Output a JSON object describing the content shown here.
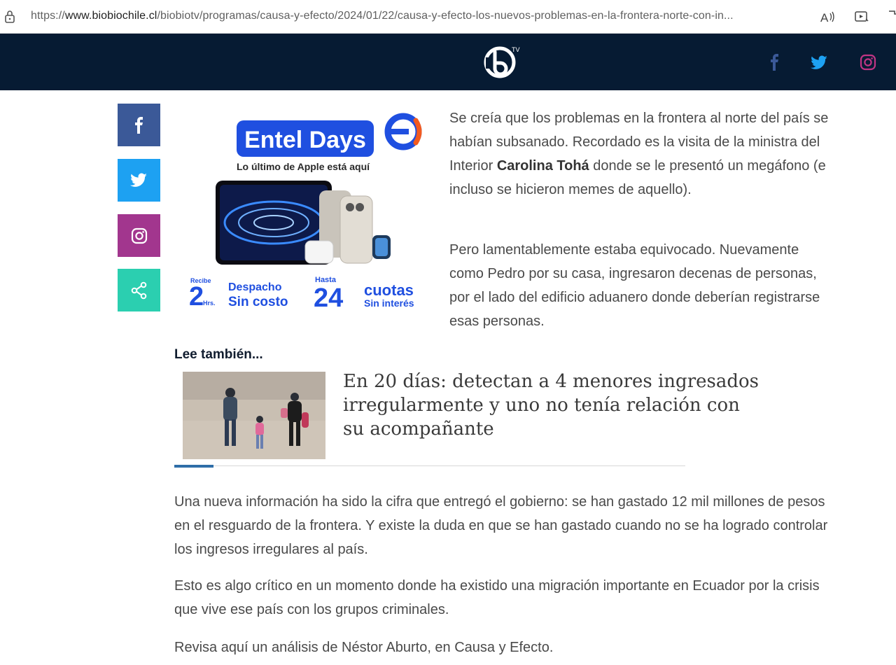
{
  "browser": {
    "url_prefix": "https://",
    "url_domain": "www.biobiochile.cl",
    "url_path": "/biobiotv/programas/causa-y-efecto/2024/01/22/causa-y-efecto-los-nuevos-problemas-en-la-frontera-norte-con-in..."
  },
  "header": {
    "logo_text": "TV",
    "socials": [
      "facebook-icon",
      "twitter-icon",
      "instagram-icon"
    ],
    "colors": {
      "background": "#061b33",
      "facebook": "#3b5998",
      "twitter": "#1da1f2",
      "instagram": "#c13584"
    }
  },
  "share": {
    "buttons": [
      {
        "icon": "facebook-icon",
        "color": "#3b5998"
      },
      {
        "icon": "twitter-icon",
        "color": "#1da1f2"
      },
      {
        "icon": "instagram-icon",
        "color": "#a2368e"
      },
      {
        "icon": "share-icon",
        "color": "#2bcfb0"
      }
    ]
  },
  "ad": {
    "brand": "Entel Days",
    "subtitle": "Lo último de Apple está aquí",
    "delivery_top": "Recibe",
    "delivery_num": "2",
    "delivery_unit": "Hrs.",
    "delivery_line1": "Despacho",
    "delivery_line2": "Sin costo",
    "cuotas_top": "Hasta",
    "cuotas_num": "24",
    "cuotas_line1": "cuotas",
    "cuotas_line2": "Sin interés"
  },
  "article": {
    "p1_before": "Se creía que los problemas en la frontera al norte del país se habían subsanado. Recordado es la visita de la ministra del Interior ",
    "p1_bold": "Carolina Tohá",
    "p1_after": " donde se le presentó un megáfono (e incluso se hicieron memes de aquello).",
    "p2": "Pero lamentablemente estaba equivocado. Nuevamente como Pedro por su casa, ingresaron decenas de personas, por el lado del edificio aduanero donde deberían registrarse esas personas.",
    "p3": "Una nueva información ha sido la cifra que entregó el gobierno: se han gastado 12 mil millones de pesos en el resguardo de la frontera. Y existe la duda en que se han gastado cuando no se ha logrado controlar los ingresos irregulares al país.",
    "p4": "Esto es algo crítico en un momento donde ha existido una migración importante en Ecuador por la crisis que vive ese país con los grupos criminales.",
    "p5": "Revisa aquí un análisis de Néstor Aburto, en Causa y Efecto."
  },
  "related": {
    "label": "Lee también...",
    "title": "En 20 días: detectan a 4 menores ingresados irregularmente y uno no tenía relación con su acompañante"
  }
}
